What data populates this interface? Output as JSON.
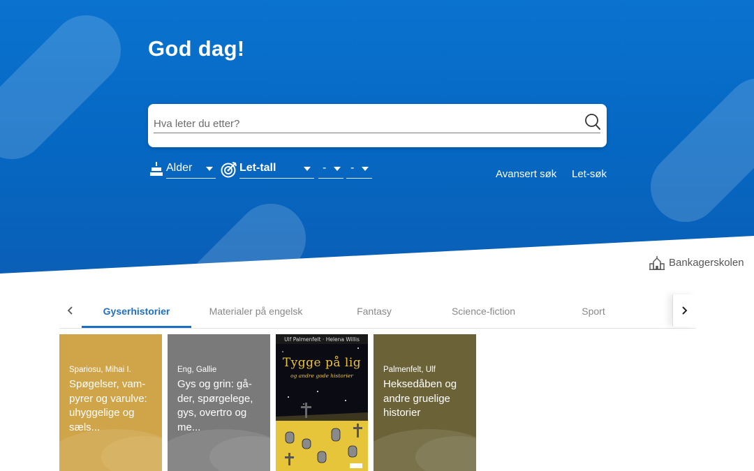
{
  "hero": {
    "greeting": "God dag!",
    "search": {
      "placeholder": "Hva leter du etter?"
    },
    "filters": {
      "age": {
        "label": "Alder"
      },
      "let_number": {
        "label": "Let-tall"
      },
      "range_from": {
        "value": "-"
      },
      "range_to": {
        "value": "-"
      }
    },
    "links": {
      "advanced": "Avansert søk",
      "let_search": "Let-søk"
    }
  },
  "school": {
    "name": "Bankagerskolen",
    "icon": "school-building-icon"
  },
  "tabs": {
    "items": [
      {
        "label": "Gyserhistorier",
        "active": true
      },
      {
        "label": "Materialer på engelsk",
        "active": false
      },
      {
        "label": "Fantasy",
        "active": false
      },
      {
        "label": "Science-fiction",
        "active": false
      },
      {
        "label": "Sport",
        "active": false
      }
    ]
  },
  "cards": [
    {
      "author": "Spariosu, Mihai I.",
      "title": "Spøgelser, vam-pyrer og varulve: uhyggelige og sæls...",
      "color": "#d0a448"
    },
    {
      "author": "Eng, Gallie",
      "title": "Gys og grin: gå-der, spørgelege, gys, overtro og me...",
      "color": "#7a7a7a"
    },
    {
      "cover_top": "Ulf Palmenfelt · Helena Willis",
      "cover_title": "Tygge på lig",
      "cover_sub": "og andre gode historier"
    },
    {
      "author": "Palmenfelt, Ulf",
      "title": "Heksedåben og andre gruelige historier",
      "color": "#6b6337"
    }
  ],
  "colors": {
    "hero_blue": "#0567c2",
    "accent": "#1a6fc5"
  }
}
